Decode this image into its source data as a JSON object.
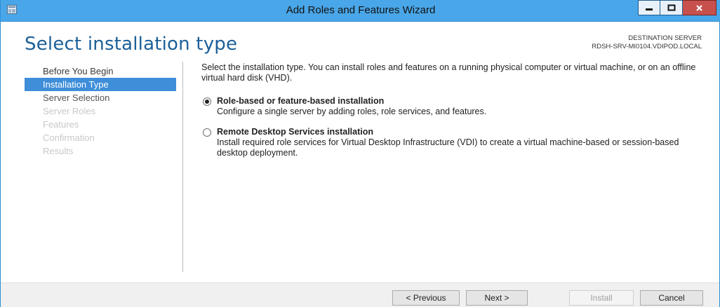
{
  "window": {
    "title": "Add Roles and Features Wizard",
    "controls": {
      "minimize": "—",
      "maximize": "□",
      "close": "✕"
    }
  },
  "header": {
    "page_title": "Select installation type",
    "destination_label": "DESTINATION SERVER",
    "destination_server": "RDSH-SRV-MI0104.VDIPOD.LOCAL"
  },
  "nav": {
    "items": [
      {
        "label": "Before You Begin",
        "state": "done"
      },
      {
        "label": "Installation Type",
        "state": "active"
      },
      {
        "label": "Server Selection",
        "state": "next"
      },
      {
        "label": "Server Roles",
        "state": "disabled"
      },
      {
        "label": "Features",
        "state": "disabled"
      },
      {
        "label": "Confirmation",
        "state": "disabled"
      },
      {
        "label": "Results",
        "state": "disabled"
      }
    ]
  },
  "content": {
    "intro": "Select the installation type. You can install roles and features on a running physical computer or virtual machine, or on an offline virtual hard disk (VHD).",
    "options": [
      {
        "title": "Role-based or feature-based installation",
        "description": "Configure a single server by adding roles, role services, and features.",
        "selected": true
      },
      {
        "title": "Remote Desktop Services installation",
        "description": "Install required role services for Virtual Desktop Infrastructure (VDI) to create a virtual machine-based or session-based desktop deployment.",
        "selected": false
      }
    ]
  },
  "footer": {
    "previous": "< Previous",
    "next": "Next >",
    "install": "Install",
    "cancel": "Cancel"
  },
  "colors": {
    "titlebar": "#49a6e8",
    "page_title": "#1c5f98",
    "nav_active": "#3e8ed9",
    "close_button": "#c7504d"
  }
}
